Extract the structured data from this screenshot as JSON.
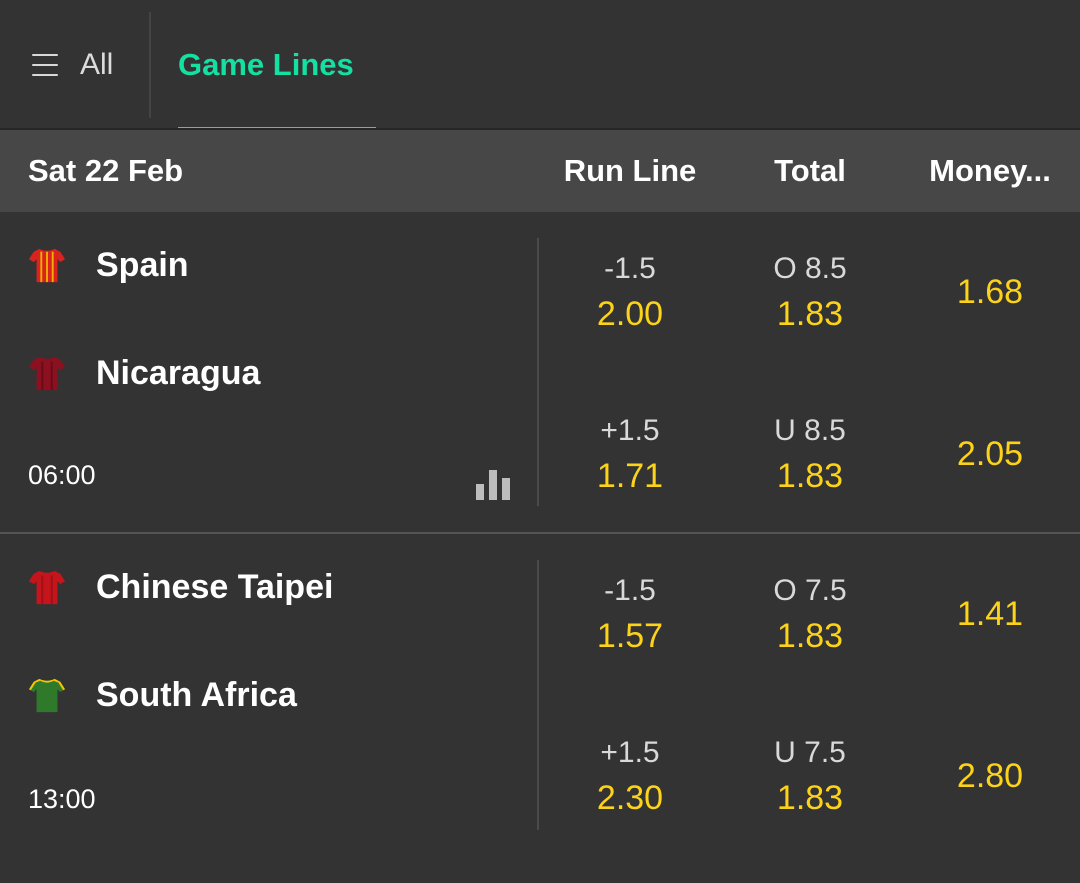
{
  "tabs": {
    "all_label": "All",
    "active_label": "Game Lines"
  },
  "colors": {
    "accent": "#14e0a2",
    "odds": "#fdd31a",
    "background": "#333333",
    "header": "#474747"
  },
  "header": {
    "date": "Sat 22 Feb",
    "col_run_line": "Run Line",
    "col_total": "Total",
    "col_money": "Money..."
  },
  "matches": [
    {
      "home": {
        "name": "Spain",
        "jersey_color": "#d8231f",
        "jersey_stripe": "#f0b000"
      },
      "away": {
        "name": "Nicaragua",
        "jersey_color": "#8b1020",
        "jersey_stripe": "#6a0a18"
      },
      "time": "06:00",
      "run_line": [
        {
          "line": "-1.5",
          "price": "2.00"
        },
        {
          "line": "+1.5",
          "price": "1.71"
        }
      ],
      "total": [
        {
          "line": "O 8.5",
          "price": "1.83"
        },
        {
          "line": "U 8.5",
          "price": "1.83"
        }
      ],
      "money": [
        "1.68",
        "2.05"
      ]
    },
    {
      "home": {
        "name": "Chinese Taipei",
        "jersey_color": "#c4141c",
        "jersey_stripe": "#a00f16"
      },
      "away": {
        "name": "South Africa",
        "jersey_color": "#2f7a2a",
        "jersey_stripe": "#f2c500"
      },
      "time": "13:00",
      "run_line": [
        {
          "line": "-1.5",
          "price": "1.57"
        },
        {
          "line": "+1.5",
          "price": "2.30"
        }
      ],
      "total": [
        {
          "line": "O 7.5",
          "price": "1.83"
        },
        {
          "line": "U 7.5",
          "price": "1.83"
        }
      ],
      "money": [
        "1.41",
        "2.80"
      ]
    }
  ]
}
